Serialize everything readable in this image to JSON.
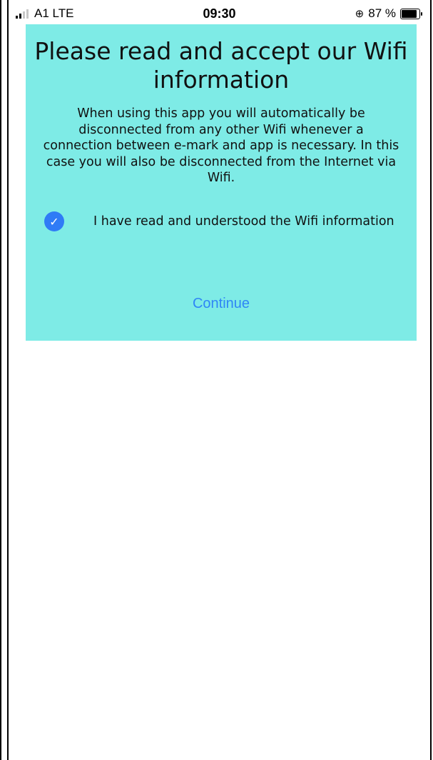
{
  "status_bar": {
    "carrier": "A1  LTE",
    "time": "09:30",
    "battery": "87 %",
    "lock_icon": "orientation-lock-icon",
    "signal_icon": "signal-strength-icon",
    "battery_icon": "battery-icon"
  },
  "dialog": {
    "title": "Please read and accept our Wifi information",
    "body": "When using this app you will automatically be disconnected from any other Wifi whenever a connection between e-mark and app is necessary. In this case you will also be disconnected from the Internet via Wifi.",
    "consent_label": "I have read and understood the Wifi information",
    "consent_checked": true,
    "continue_label": "Continue"
  },
  "colors": {
    "card_background": "#7eebe6",
    "accent_blue": "#2f86f6"
  }
}
